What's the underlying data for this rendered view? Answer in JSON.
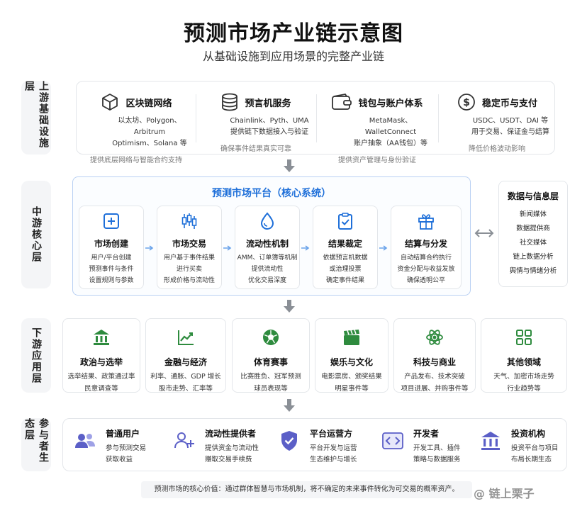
{
  "header": {
    "title": "预测市场产业链示意图",
    "subtitle": "从基础设施到应用场景的完整产业链"
  },
  "layers": {
    "upstream": "上游基础设施层",
    "midstream": "中游核心层",
    "downstream": "下游应用层",
    "participants": "参与者生态层"
  },
  "upstream": [
    {
      "name": "区块链网络",
      "icon": "cube-icon",
      "desc1": "以太坊、Polygon、Arbitrum",
      "desc2": "Optimism、Solana 等",
      "sub": "提供底层网络与智能合约支持"
    },
    {
      "name": "预言机服务",
      "icon": "database-icon",
      "desc1": "Chainlink、Pyth、UMA",
      "desc2": "提供链下数据接入与验证",
      "sub": "确保事件结果真实可靠"
    },
    {
      "name": "钱包与账户体系",
      "icon": "wallet-icon",
      "desc1": "MetaMask、WalletConnect",
      "desc2": "账户抽象（AA钱包）等",
      "sub": "提供资产管理与身份验证"
    },
    {
      "name": "稳定币与支付",
      "icon": "dollar-icon",
      "desc1": "USDC、USDT、DAI 等",
      "desc2": "用于交易、保证金与结算",
      "sub": "降低价格波动影响"
    }
  ],
  "core": {
    "title": "预测市场平台（核心系统）",
    "steps": [
      {
        "name": "市场创建",
        "icon": "plus-square-icon",
        "d1": "用户/平台创建",
        "d2": "预测事件与条件",
        "d3": "设置规则与参数"
      },
      {
        "name": "市场交易",
        "icon": "candlestick-icon",
        "d1": "用户基于事件结果",
        "d2": "进行买卖",
        "d3": "形成价格与流动性"
      },
      {
        "name": "流动性机制",
        "icon": "droplet-icon",
        "d1": "AMM、订单簿等机制",
        "d2": "提供流动性",
        "d3": "优化交易深度"
      },
      {
        "name": "结果裁定",
        "icon": "clipboard-check-icon",
        "d1": "依据预言机数据",
        "d2": "或治理投票",
        "d3": "确定事件结果"
      },
      {
        "name": "结算与分发",
        "icon": "gift-icon",
        "d1": "自动结算合约执行",
        "d2": "资金分配与收益发放",
        "d3": "确保透明公平"
      }
    ]
  },
  "info": {
    "title": "数据与信息层",
    "items": [
      "新闻媒体",
      "数据提供商",
      "社交媒体",
      "链上数据分析",
      "舆情与情绪分析"
    ]
  },
  "downstream": [
    {
      "name": "政治与选举",
      "icon": "bank-icon",
      "d1": "选举结果、政策通过率",
      "d2": "民意调查等"
    },
    {
      "name": "金融与经济",
      "icon": "line-chart-icon",
      "d1": "利率、通胀、GDP 增长",
      "d2": "股市走势、汇率等"
    },
    {
      "name": "体育赛事",
      "icon": "soccer-ball-icon",
      "d1": "比赛胜负、冠军预测",
      "d2": "球员表现等"
    },
    {
      "name": "娱乐与文化",
      "icon": "clapperboard-icon",
      "d1": "电影票房、颁奖结果",
      "d2": "明星事件等"
    },
    {
      "name": "科技与商业",
      "icon": "atom-icon",
      "d1": "产品发布、技术突破",
      "d2": "项目进展、并购事件等"
    },
    {
      "name": "其他领域",
      "icon": "grid-icon",
      "d1": "天气、加密市场走势",
      "d2": "行业趋势等"
    }
  ],
  "participants": [
    {
      "name": "普通用户",
      "icon": "users-icon",
      "d1": "参与预测交易",
      "d2": "获取收益"
    },
    {
      "name": "流动性提供者",
      "icon": "user-plus-icon",
      "d1": "提供资金与流动性",
      "d2": "赚取交易手续费"
    },
    {
      "name": "平台运营方",
      "icon": "shield-check-icon",
      "d1": "平台开发与运营",
      "d2": "生态维护与增长"
    },
    {
      "name": "开发者",
      "icon": "code-icon",
      "d1": "开发工具、插件",
      "d2": "策略与数据服务"
    },
    {
      "name": "投资机构",
      "icon": "institution-icon",
      "d1": "投资平台与项目",
      "d2": "布局长期生态"
    }
  ],
  "footer": "预测市场的核心价值：通过群体智慧与市场机制，将不确定的未来事件转化为可交易的概率资产。",
  "watermark": "@ 链上栗子",
  "colors": {
    "accent": "#1e6fd9",
    "green": "#2e8b3e",
    "purple": "#5b5fc7",
    "arrow": "#8a8f96"
  }
}
